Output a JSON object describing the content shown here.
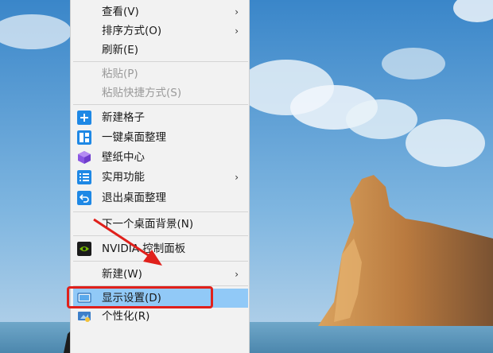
{
  "menu": {
    "items": [
      {
        "label": "查看(V)",
        "submenu": true
      },
      {
        "label": "排序方式(O)",
        "submenu": true
      },
      {
        "label": "刷新(E)"
      },
      {
        "label": "粘贴(P)",
        "disabled": true
      },
      {
        "label": "粘贴快捷方式(S)",
        "disabled": true
      },
      {
        "label": "新建格子",
        "icon": "plus-icon"
      },
      {
        "label": "一键桌面整理",
        "icon": "layout-icon"
      },
      {
        "label": "壁纸中心",
        "icon": "cube-icon"
      },
      {
        "label": "实用功能",
        "icon": "list-icon",
        "submenu": true
      },
      {
        "label": "退出桌面整理",
        "icon": "exit-icon"
      },
      {
        "label": "下一个桌面背景(N)"
      },
      {
        "label": "NVIDIA 控制面板",
        "icon": "nvidia-icon"
      },
      {
        "label": "新建(W)",
        "submenu": true
      },
      {
        "label": "显示设置(D)",
        "icon": "display-icon",
        "selected": true
      },
      {
        "label": "个性化(R)",
        "icon": "personalize-icon"
      }
    ]
  },
  "colors": {
    "accent_blue": "#1e88e5",
    "highlight_red": "#e0201b",
    "selected_bg": "#91c9f7"
  }
}
